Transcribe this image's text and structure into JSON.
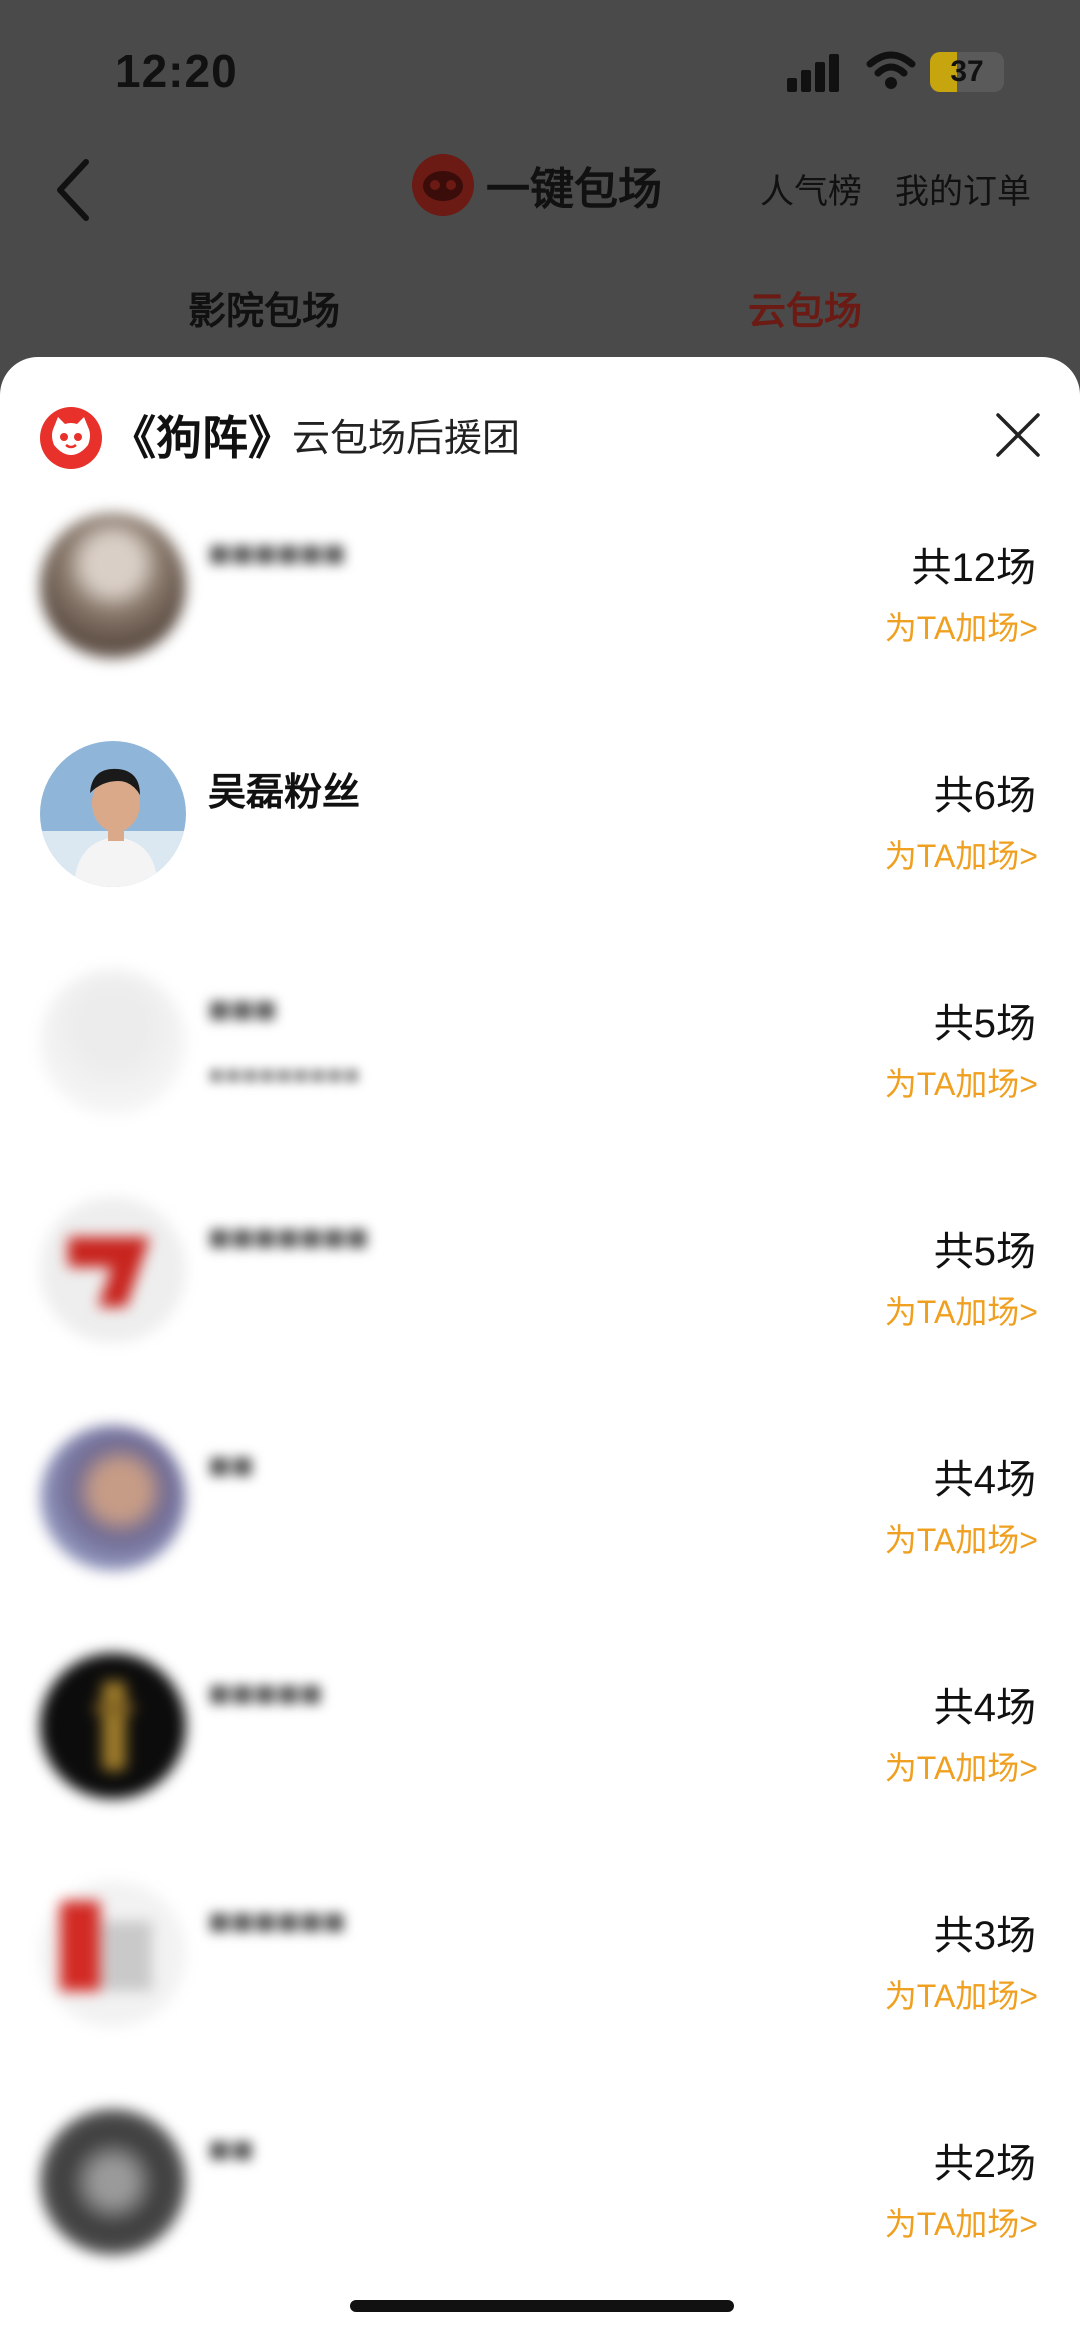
{
  "status_bar": {
    "time": "12:20",
    "battery": "37",
    "battery_level": 0.37
  },
  "nav": {
    "title": "一键包场",
    "links": [
      "人气榜",
      "我的订单"
    ]
  },
  "tabs": [
    "影院包场",
    "云包场"
  ],
  "sheet": {
    "movie": "《狗阵》",
    "subtitle": "云包场后援团"
  },
  "fans": [
    {
      "name": "",
      "sub": "",
      "count": "共12场",
      "action": "为TA加场>"
    },
    {
      "name": "吴磊粉丝",
      "sub": "",
      "count": "共6场",
      "action": "为TA加场>"
    },
    {
      "name": "",
      "sub": "",
      "count": "共5场",
      "action": "为TA加场>"
    },
    {
      "name": "",
      "sub": "",
      "count": "共5场",
      "action": "为TA加场>"
    },
    {
      "name": "",
      "sub": "",
      "count": "共4场",
      "action": "为TA加场>"
    },
    {
      "name": "",
      "sub": "",
      "count": "共4场",
      "action": "为TA加场>"
    },
    {
      "name": "",
      "sub": "",
      "count": "共3场",
      "action": "为TA加场>"
    },
    {
      "name": "",
      "sub": "",
      "count": "共2场",
      "action": "为TA加场>"
    }
  ],
  "colors": {
    "accent": "#f0a020",
    "brand_red": "#e8312b",
    "active_tab": "#6b1a14"
  }
}
